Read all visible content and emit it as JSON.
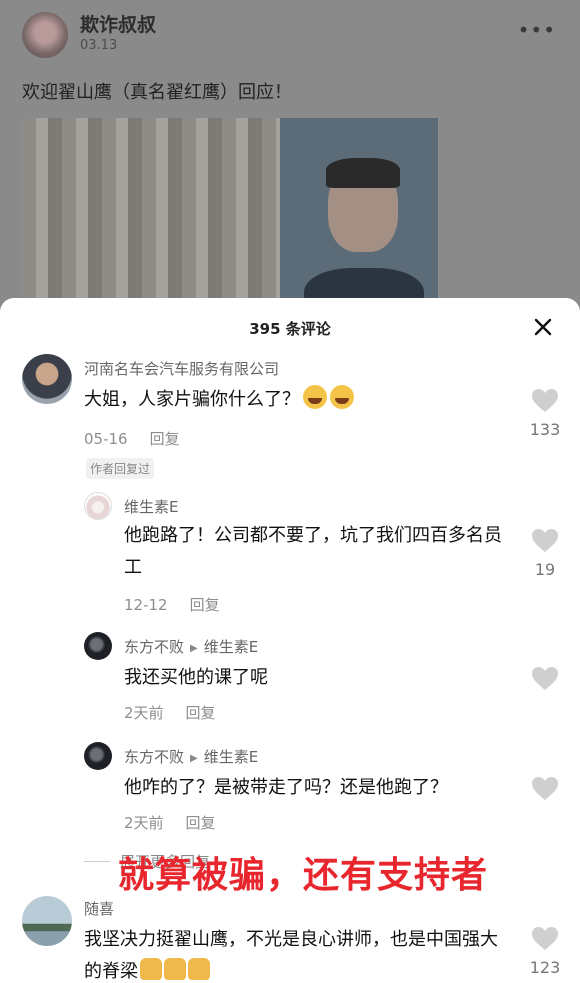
{
  "post": {
    "author": "欺诈叔叔",
    "date": "03.13",
    "more_icon": "more-dots-icon",
    "text": "欢迎翟山鹰（真名翟红鹰）回应！"
  },
  "sheet": {
    "title": "395 条评论",
    "close_icon": "close-icon"
  },
  "comments": [
    {
      "name": "河南名车会汽车服务有限公司",
      "text": "大姐，人家片骗你什么了？",
      "emoji": "laughing-crying-emoji",
      "date": "05-16",
      "reply_label": "回复",
      "badge": "作者回复过",
      "likes": "133"
    },
    {
      "name": "维生素E",
      "text": "他跑路了！公司都不要了，坑了我们四百多名员工",
      "date": "12-12",
      "reply_label": "回复",
      "likes": "19"
    },
    {
      "name": "东方不败",
      "reply_to": "维生素E",
      "text": "我还买他的课了呢",
      "date": "2天前",
      "reply_label": "回复",
      "likes": ""
    },
    {
      "name": "东方不败",
      "reply_to": "维生素E",
      "text": "他咋的了？是被带走了吗？还是他跑了？",
      "date": "2天前",
      "reply_label": "回复",
      "likes": ""
    },
    {
      "name": "随喜",
      "text": "我坚决力挺翟山鹰，不光是良心讲师，也是中国强大的脊梁",
      "emoji": "thumbs-up-emoji",
      "likes": "123"
    }
  ],
  "expand_label": "展开更多回复",
  "overlay_caption": "就算被骗，还有支持者",
  "colors": {
    "caption": "#e8262d",
    "sheet_bg": "#ffffff",
    "dim_bg": "#8a8a8a"
  }
}
